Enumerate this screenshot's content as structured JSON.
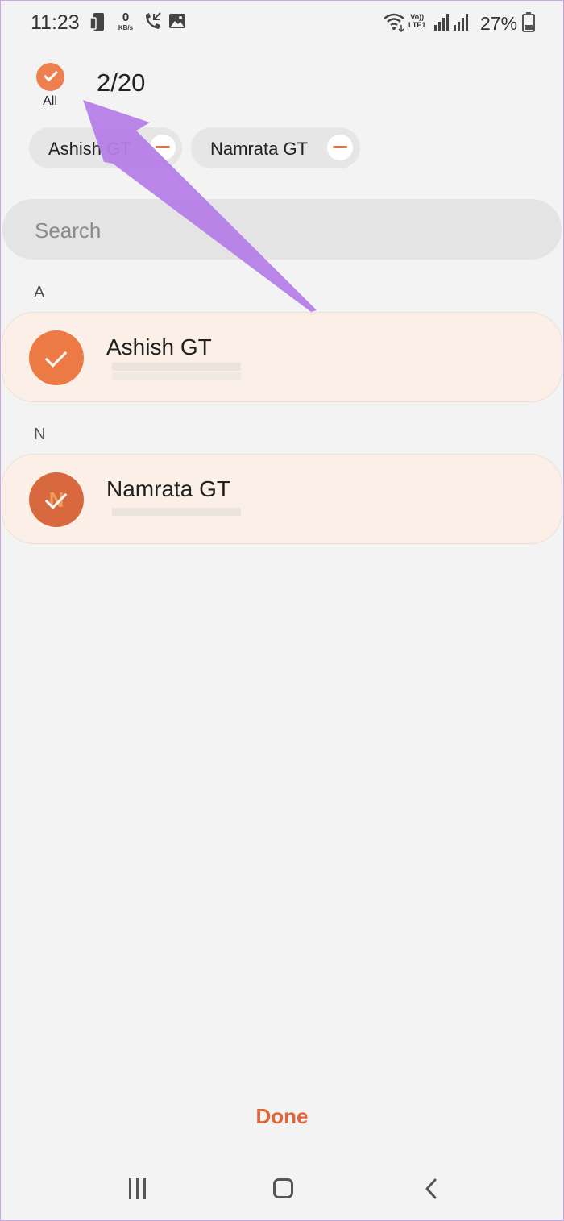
{
  "status_bar": {
    "time": "11:23",
    "net_speed_value": "0",
    "net_speed_unit": "KB/s",
    "volte_top": "Vo))",
    "volte_bottom": "LTE1",
    "battery_percent": "27%",
    "icons": [
      "phone-mirror-icon",
      "missed-call-icon",
      "image-icon",
      "wifi-icon",
      "signal-icon",
      "signal-icon",
      "battery-icon"
    ]
  },
  "header": {
    "select_all_label": "All",
    "selected_count": "2/20"
  },
  "chips": [
    {
      "label": "Ashish GT"
    },
    {
      "label": "Namrata GT"
    }
  ],
  "search": {
    "placeholder": "Search"
  },
  "sections": [
    {
      "letter": "A",
      "contacts": [
        {
          "name": "Ashish GT",
          "avatar_letter": "",
          "checked": true
        }
      ]
    },
    {
      "letter": "N",
      "contacts": [
        {
          "name": "Namrata GT",
          "avatar_letter": "N",
          "checked": true
        }
      ]
    }
  ],
  "footer": {
    "done_label": "Done"
  },
  "nav_bar": {
    "icons": [
      "recents-icon",
      "home-icon",
      "back-icon"
    ]
  },
  "colors": {
    "accent": "#e0663a",
    "avatar_a": "#ec7a45",
    "avatar_n": "#d8693e",
    "card_bg": "#fbefe8",
    "annotation_arrow": "#b57ee8"
  }
}
